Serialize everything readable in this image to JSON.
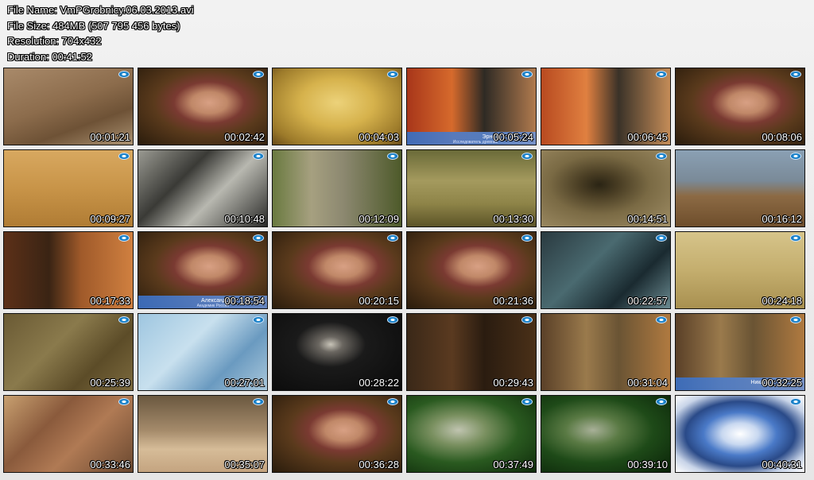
{
  "header": {
    "file_name": "File Name: VmPGrobnicy.06.03.2013.avi",
    "file_size": "File Size: 484MB (507 795 456 bytes)",
    "resolution": "Resolution: 704x432",
    "duration": "Duration: 00:41:52"
  },
  "thumbnails": [
    {
      "time": "00:01:21",
      "scene": "pyramid-closeup",
      "bg": "linear-gradient(160deg,#a98a6a 0%,#8c6c4c 45%,#6e5236 70%,#a99070 100%)"
    },
    {
      "time": "00:02:42",
      "scene": "interview-man",
      "bg": "radial-gradient(ellipse at 55% 45%,#d8a084 0%,#c08868 18%,#7a3a32 35%,#5a3a1c 55%,#2a1c0c 100%)"
    },
    {
      "time": "00:04:03",
      "scene": "ancient-map",
      "bg": "radial-gradient(ellipse at 50% 45%,#ecd27a 0%,#d6b24c 40%,#9c7a2a 80%,#6a4c1a 100%)"
    },
    {
      "time": "00:05:24",
      "scene": "interview-bald-man",
      "caption": "Эрнст",
      "subcaption": "Исследователь древних",
      "bg": "linear-gradient(90deg,#a8361a 0%,#d66a2c 35%,#2e2a24 60%,#b07a4e 100%)"
    },
    {
      "time": "00:06:45",
      "scene": "interview-bald-man",
      "bg": "linear-gradient(90deg,#b84a20 0%,#e08040 35%,#3a3228 60%,#c48c58 100%)"
    },
    {
      "time": "00:08:06",
      "scene": "interview-man",
      "bg": "radial-gradient(ellipse at 55% 45%,#d8a084 0%,#c08868 18%,#7a3a32 35%,#5a3a1c 55%,#2a1c0c 100%)"
    },
    {
      "time": "00:09:27",
      "scene": "hieroglyph-wall",
      "bg": "linear-gradient(180deg,#d8a860 0%,#c89448 50%,#b07c34 100%)"
    },
    {
      "time": "00:10:48",
      "scene": "old-photo-jungle",
      "bg": "linear-gradient(135deg,#9a9a92 0%,#3a3a36 35%,#b8b8b0 60%,#2a2a28 100%)"
    },
    {
      "time": "00:12:09",
      "scene": "tree-jungle",
      "bg": "linear-gradient(90deg,#6a7a40 0%,#a6a080 30%,#8c8870 55%,#4e5a2a 100%)"
    },
    {
      "time": "00:13:30",
      "scene": "stone-block",
      "bg": "linear-gradient(180deg,#6a6a38 0%,#a49a5e 40%,#8e8448 70%,#5c5428 100%)"
    },
    {
      "time": "00:14:51",
      "scene": "tunnel",
      "bg": "radial-gradient(ellipse at 45% 45%,#2a2414 0%,#4a3e24 20%,#7a6a44 50%,#a08e66 100%)"
    },
    {
      "time": "00:16:12",
      "scene": "pyramid-distance",
      "bg": "linear-gradient(180deg,#8aa0b4 0%,#7a8a98 40%,#8c6a44 60%,#6e4e2c 100%)"
    },
    {
      "time": "00:17:33",
      "scene": "interview-glasses-man",
      "bg": "linear-gradient(90deg,#5c3018 0%,#3a2414 35%,#a05a2a 60%,#d08040 100%)"
    },
    {
      "time": "00:18:54",
      "scene": "interview-man",
      "caption": "Александр",
      "subcaption": "Академик Россия",
      "bg": "radial-gradient(ellipse at 55% 45%,#d8a084 0%,#c08868 18%,#7a3a32 35%,#5a3a1c 55%,#2a1c0c 100%)"
    },
    {
      "time": "00:20:15",
      "scene": "interview-man",
      "bg": "radial-gradient(ellipse at 55% 45%,#d8a084 0%,#c08868 18%,#7a3a32 35%,#5a3a1c 55%,#2a1c0c 100%)"
    },
    {
      "time": "00:21:36",
      "scene": "interview-man",
      "bg": "radial-gradient(ellipse at 55% 45%,#d8a084 0%,#c08868 18%,#7a3a32 35%,#5a3a1c 55%,#2a1c0c 100%)"
    },
    {
      "time": "00:22:57",
      "scene": "underwater",
      "bg": "linear-gradient(135deg,#2a3a40 0%,#4a6a70 40%,#1a2a30 70%,#6a8a90 100%)"
    },
    {
      "time": "00:24:18",
      "scene": "carved-stone",
      "bg": "linear-gradient(180deg,#d6c48a 0%,#c4ae6e 50%,#a89050 100%)"
    },
    {
      "time": "00:25:39",
      "scene": "cracked-ground",
      "bg": "linear-gradient(135deg,#6a5a34 0%,#8a7a4c 40%,#5c4c28 70%,#7c6a3e 100%)"
    },
    {
      "time": "00:27:01",
      "scene": "ice-scene",
      "bg": "linear-gradient(135deg,#9ec6e0 0%,#c8e0ee 40%,#6a9ac0 70%,#aac8dc 100%)"
    },
    {
      "time": "00:28:22",
      "scene": "dark-light",
      "bg": "radial-gradient(ellipse at 45% 40%,#c8c4b8 0%,#6a6660 12%,#1a1a1a 35%,#0a0a0a 100%)"
    },
    {
      "time": "00:29:43",
      "scene": "interview-woman",
      "bg": "linear-gradient(90deg,#3a2818 0%,#5a3a20 35%,#2a1c10 60%,#4a3018 100%)"
    },
    {
      "time": "00:31:04",
      "scene": "interview-long-hair-man",
      "bg": "linear-gradient(90deg,#5a4028 0%,#9a7a4c 35%,#6a5434 60%,#b07a40 100%)"
    },
    {
      "time": "00:32:25",
      "scene": "interview-long-hair-man",
      "caption": "Никас",
      "subcaption": "",
      "bg": "linear-gradient(90deg,#5a4028 0%,#9a7a4c 35%,#6a5434 60%,#b07a40 100%)"
    },
    {
      "time": "00:33:46",
      "scene": "bald-man-pyramid",
      "bg": "linear-gradient(135deg,#c8a070 0%,#8a5a3c 35%,#b07a54 60%,#6a4830 100%)"
    },
    {
      "time": "00:35:07",
      "scene": "desert-pyramid",
      "bg": "linear-gradient(180deg,#6a5840 0%,#a48a6a 45%,#d6bc98 70%,#c4a480 100%)"
    },
    {
      "time": "00:36:28",
      "scene": "interview-man",
      "bg": "radial-gradient(ellipse at 55% 45%,#d8a084 0%,#c08868 18%,#7a3a32 35%,#5a3a1c 55%,#2a1c0c 100%)"
    },
    {
      "time": "00:37:49",
      "scene": "interview-green-bg",
      "bg": "radial-gradient(ellipse at 40% 45%,#c0c4b0 0%,#7a9060 25%,#2a5a20 55%,#0e2a0a 100%)"
    },
    {
      "time": "00:39:10",
      "scene": "interview-green-bg",
      "bg": "radial-gradient(ellipse at 40% 45%,#a8b098 0%,#5a7a44 25%,#1e4a18 55%,#0a2208 100%)"
    },
    {
      "time": "00:40:31",
      "scene": "channel-logo",
      "bg": "radial-gradient(ellipse at 50% 50%,#ffffff 0%,#c8d8f0 20%,#4a7ac8 40%,#2a4a88 60%,#c8d4e8 80%,#ffffff 100%)"
    }
  ]
}
